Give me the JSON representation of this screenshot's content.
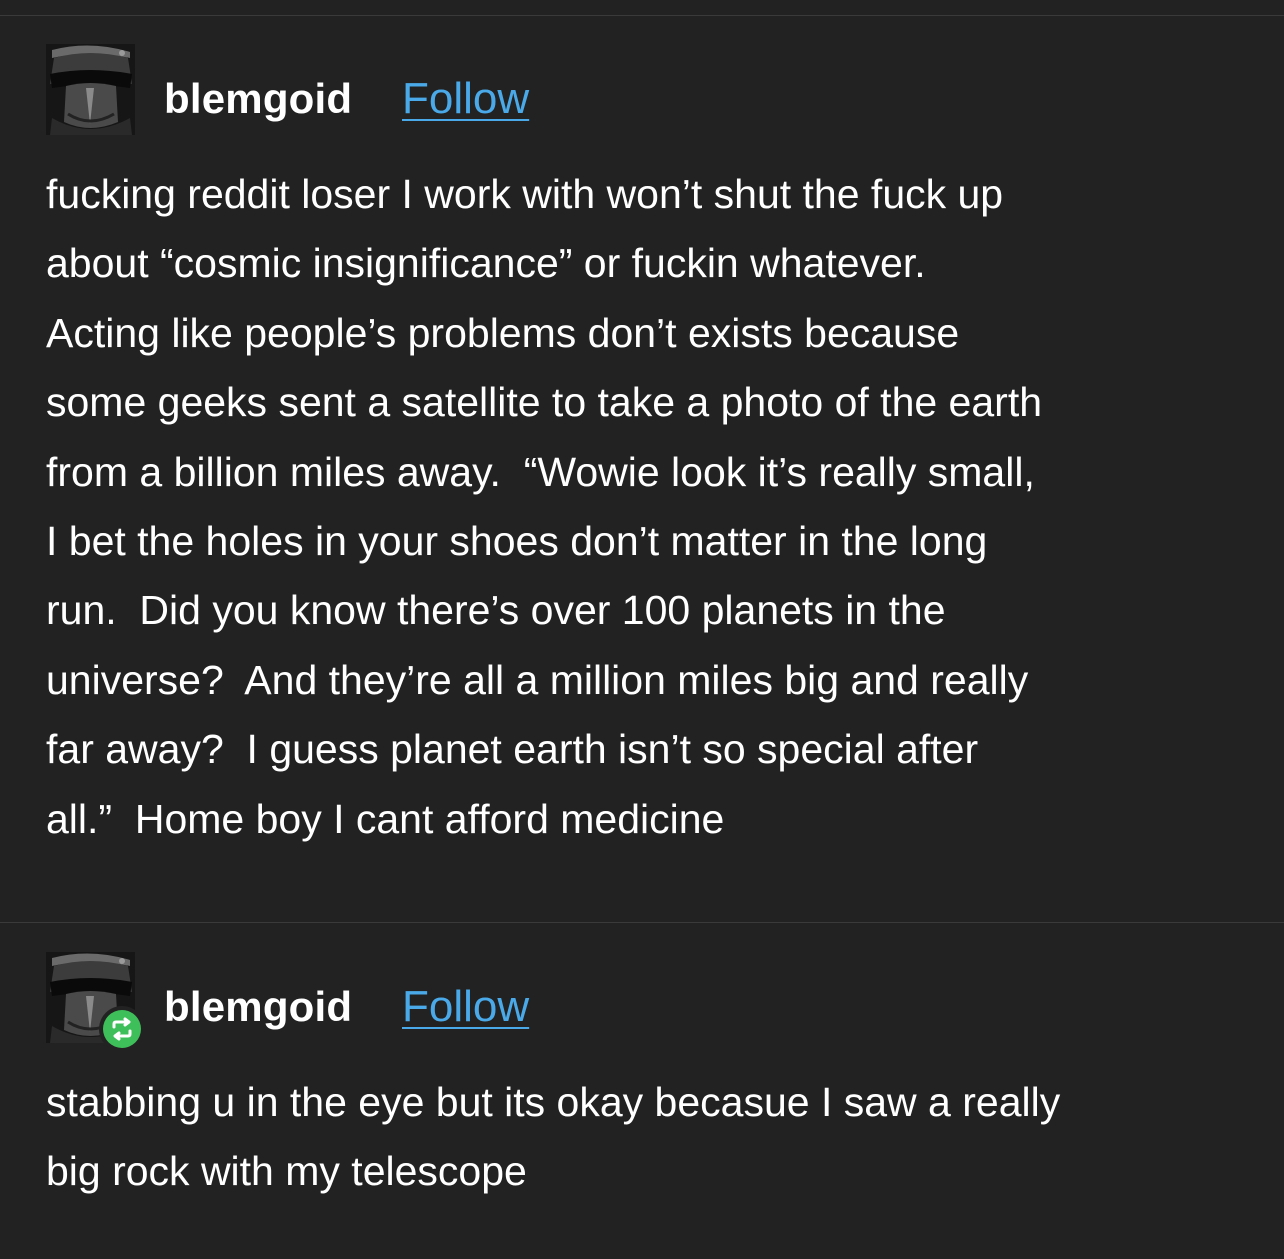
{
  "posts": [
    {
      "username": "blemgoid",
      "follow_label": "Follow",
      "is_reblog": false,
      "body_lines": [
        "fucking reddit loser I work with won’t shut the fuck up",
        "about “cosmic insignificance” or fuckin whatever.",
        "Acting like people’s problems don’t exists because",
        "some geeks sent a satellite to take a photo of the earth",
        "from a billion miles away.  “Wowie look it’s really small,",
        "I bet the holes in your shoes don’t matter in the long",
        "run.  Did you know there’s over 100 planets in the",
        "universe?  And they’re all a million miles big and really",
        "far away?  I guess planet earth isn’t so special after",
        "all.”  Home boy I cant afford medicine"
      ]
    },
    {
      "username": "blemgoid",
      "follow_label": "Follow",
      "is_reblog": true,
      "body_lines": [
        "stabbing u in the eye but its okay becasue I saw a really",
        "big rock with my telescope"
      ]
    }
  ],
  "colors": {
    "background": "#222222",
    "text": "#ffffff",
    "link": "#4aa9e8",
    "reblog_badge": "#3fbf5a",
    "divider": "#3a3a3a"
  },
  "icons": {
    "avatar": "helmet-avatar-icon",
    "reblog": "reblog-icon"
  }
}
